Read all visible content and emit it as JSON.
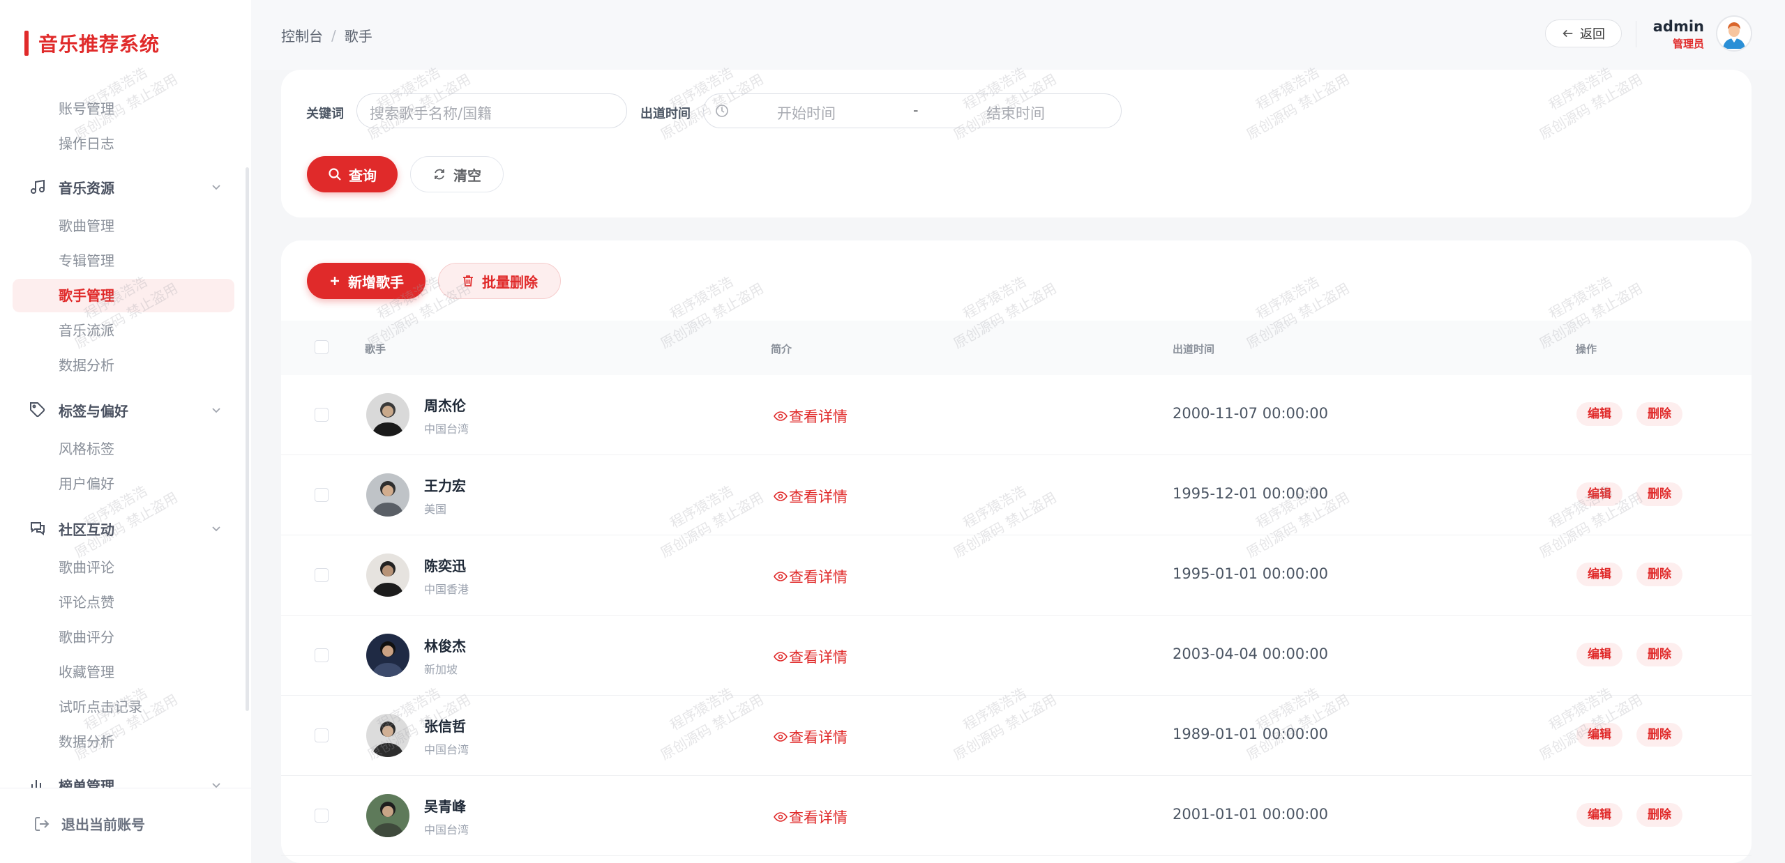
{
  "brand": {
    "title": "音乐推荐系统",
    "color": "#e02a2a"
  },
  "sidebar": {
    "items": [
      {
        "type": "sub",
        "label": "账号管理"
      },
      {
        "type": "sub",
        "label": "操作日志"
      },
      {
        "type": "group",
        "label": "音乐资源",
        "icon": "music-note-icon"
      },
      {
        "type": "sub",
        "label": "歌曲管理"
      },
      {
        "type": "sub",
        "label": "专辑管理"
      },
      {
        "type": "sub",
        "label": "歌手管理",
        "active": true
      },
      {
        "type": "sub",
        "label": "音乐流派"
      },
      {
        "type": "sub",
        "label": "数据分析"
      },
      {
        "type": "group",
        "label": "标签与偏好",
        "icon": "tag-icon"
      },
      {
        "type": "sub",
        "label": "风格标签"
      },
      {
        "type": "sub",
        "label": "用户偏好"
      },
      {
        "type": "group",
        "label": "社区互动",
        "icon": "chat-icon"
      },
      {
        "type": "sub",
        "label": "歌曲评论"
      },
      {
        "type": "sub",
        "label": "评论点赞"
      },
      {
        "type": "sub",
        "label": "歌曲评分"
      },
      {
        "type": "sub",
        "label": "收藏管理"
      },
      {
        "type": "sub",
        "label": "试听点击记录"
      },
      {
        "type": "sub",
        "label": "数据分析"
      },
      {
        "type": "group",
        "label": "榜单管理",
        "icon": "bar-chart-icon"
      }
    ],
    "logout": "退出当前账号"
  },
  "header": {
    "breadcrumb": [
      "控制台",
      "歌手"
    ],
    "breadcrumb_sep": "/",
    "back_label": "返回",
    "user_name": "admin",
    "user_role": "管理员"
  },
  "search": {
    "keyword_label": "关键词",
    "keyword_placeholder": "搜索歌手名称/国籍",
    "date_label": "出道时间",
    "start_placeholder": "开始时间",
    "range_sep": "-",
    "end_placeholder": "结束时间",
    "query_label": "查询",
    "clear_label": "清空"
  },
  "toolbar": {
    "add_label": "新增歌手",
    "batch_delete_label": "批量删除"
  },
  "table": {
    "columns": [
      "歌手",
      "简介",
      "出道时间",
      "操作"
    ],
    "detail_label": "查看详情",
    "edit_label": "编辑",
    "delete_label": "删除",
    "rows": [
      {
        "name": "周杰伦",
        "region": "中国台湾",
        "debut": "2000-11-07 00:00:00"
      },
      {
        "name": "王力宏",
        "region": "美国",
        "debut": "1995-12-01 00:00:00"
      },
      {
        "name": "陈奕迅",
        "region": "中国香港",
        "debut": "1995-01-01 00:00:00"
      },
      {
        "name": "林俊杰",
        "region": "新加坡",
        "debut": "2003-04-04 00:00:00"
      },
      {
        "name": "张信哲",
        "region": "中国台湾",
        "debut": "1989-01-01 00:00:00"
      },
      {
        "name": "吴青峰",
        "region": "中国台湾",
        "debut": "2001-01-01 00:00:00"
      }
    ]
  },
  "watermark": {
    "line1": "程序猿浩浩",
    "line2": "原创源码 禁止盗用"
  },
  "colors": {
    "primary": "#e02a2a",
    "primary_light": "#fdeeee"
  }
}
